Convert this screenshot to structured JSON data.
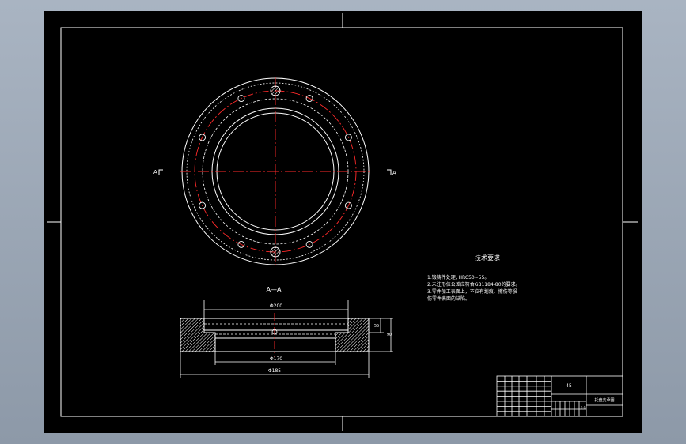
{
  "section_view": {
    "label": "A—A",
    "cut_marks": {
      "left": "A",
      "right": "A"
    }
  },
  "dimensions": {
    "top_diameter": "Φ200",
    "inner_diameter": "Φ170",
    "outer_diameter": "Φ185",
    "side_small": "55",
    "side_large": "90"
  },
  "technical_requirements": {
    "title": "技术要求",
    "lines": [
      "1.锻铸件处理, HRC50~55。",
      "2.未注形位公差应符合GB1184-80的要求。",
      "3.零件加工表面上，不应有划痕、擦伤等损",
      "伤零件表面的缺陷。"
    ]
  },
  "title_block": {
    "material": "45",
    "part_name": "托盘支承圈",
    "scale": "1:1"
  },
  "colors": {
    "background": "#000000",
    "line": "#ffffff",
    "centerline": "#ff2a2a",
    "hatch": "#ffffff"
  }
}
